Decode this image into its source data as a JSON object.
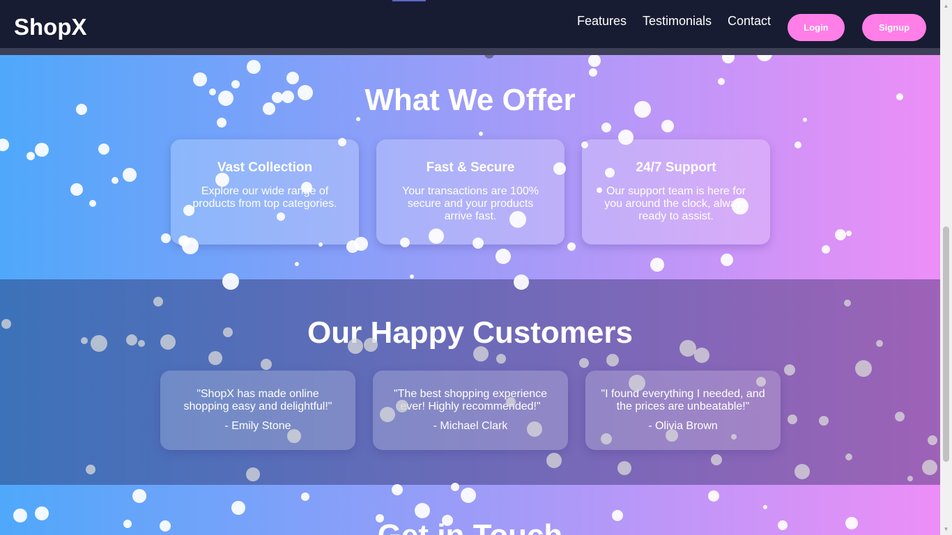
{
  "nav": {
    "logo": "ShopX",
    "links": [
      "Features",
      "Testimonials",
      "Contact"
    ],
    "login_label": "Login",
    "signup_label": "Signup"
  },
  "offer": {
    "title": "What We Offer",
    "cards": [
      {
        "title": "Vast Collection",
        "text": "Explore our wide range of products from top categories."
      },
      {
        "title": "Fast & Secure",
        "text": "Your transactions are 100% secure and your products arrive fast."
      },
      {
        "title": "24/7 Support",
        "text": "Our support team is here for you around the clock, always ready to assist."
      }
    ]
  },
  "testimonials": {
    "title": "Our Happy Customers",
    "items": [
      {
        "quote": "\"ShopX has made online shopping easy and delightful!\"",
        "author": "- Emily Stone"
      },
      {
        "quote": "\"The best shopping experience ever! Highly recommended!\"",
        "author": "- Michael Clark"
      },
      {
        "quote": "\"I found everything I needed, and the prices are unbeatable!\"",
        "author": "- Olivia Brown"
      }
    ]
  },
  "contact": {
    "title": "Get in Touch"
  },
  "colors": {
    "navbar": "#171c32",
    "button": "#ff7ee8",
    "gradient_start": "#4fa8fb",
    "gradient_end": "#ef8ef7"
  }
}
